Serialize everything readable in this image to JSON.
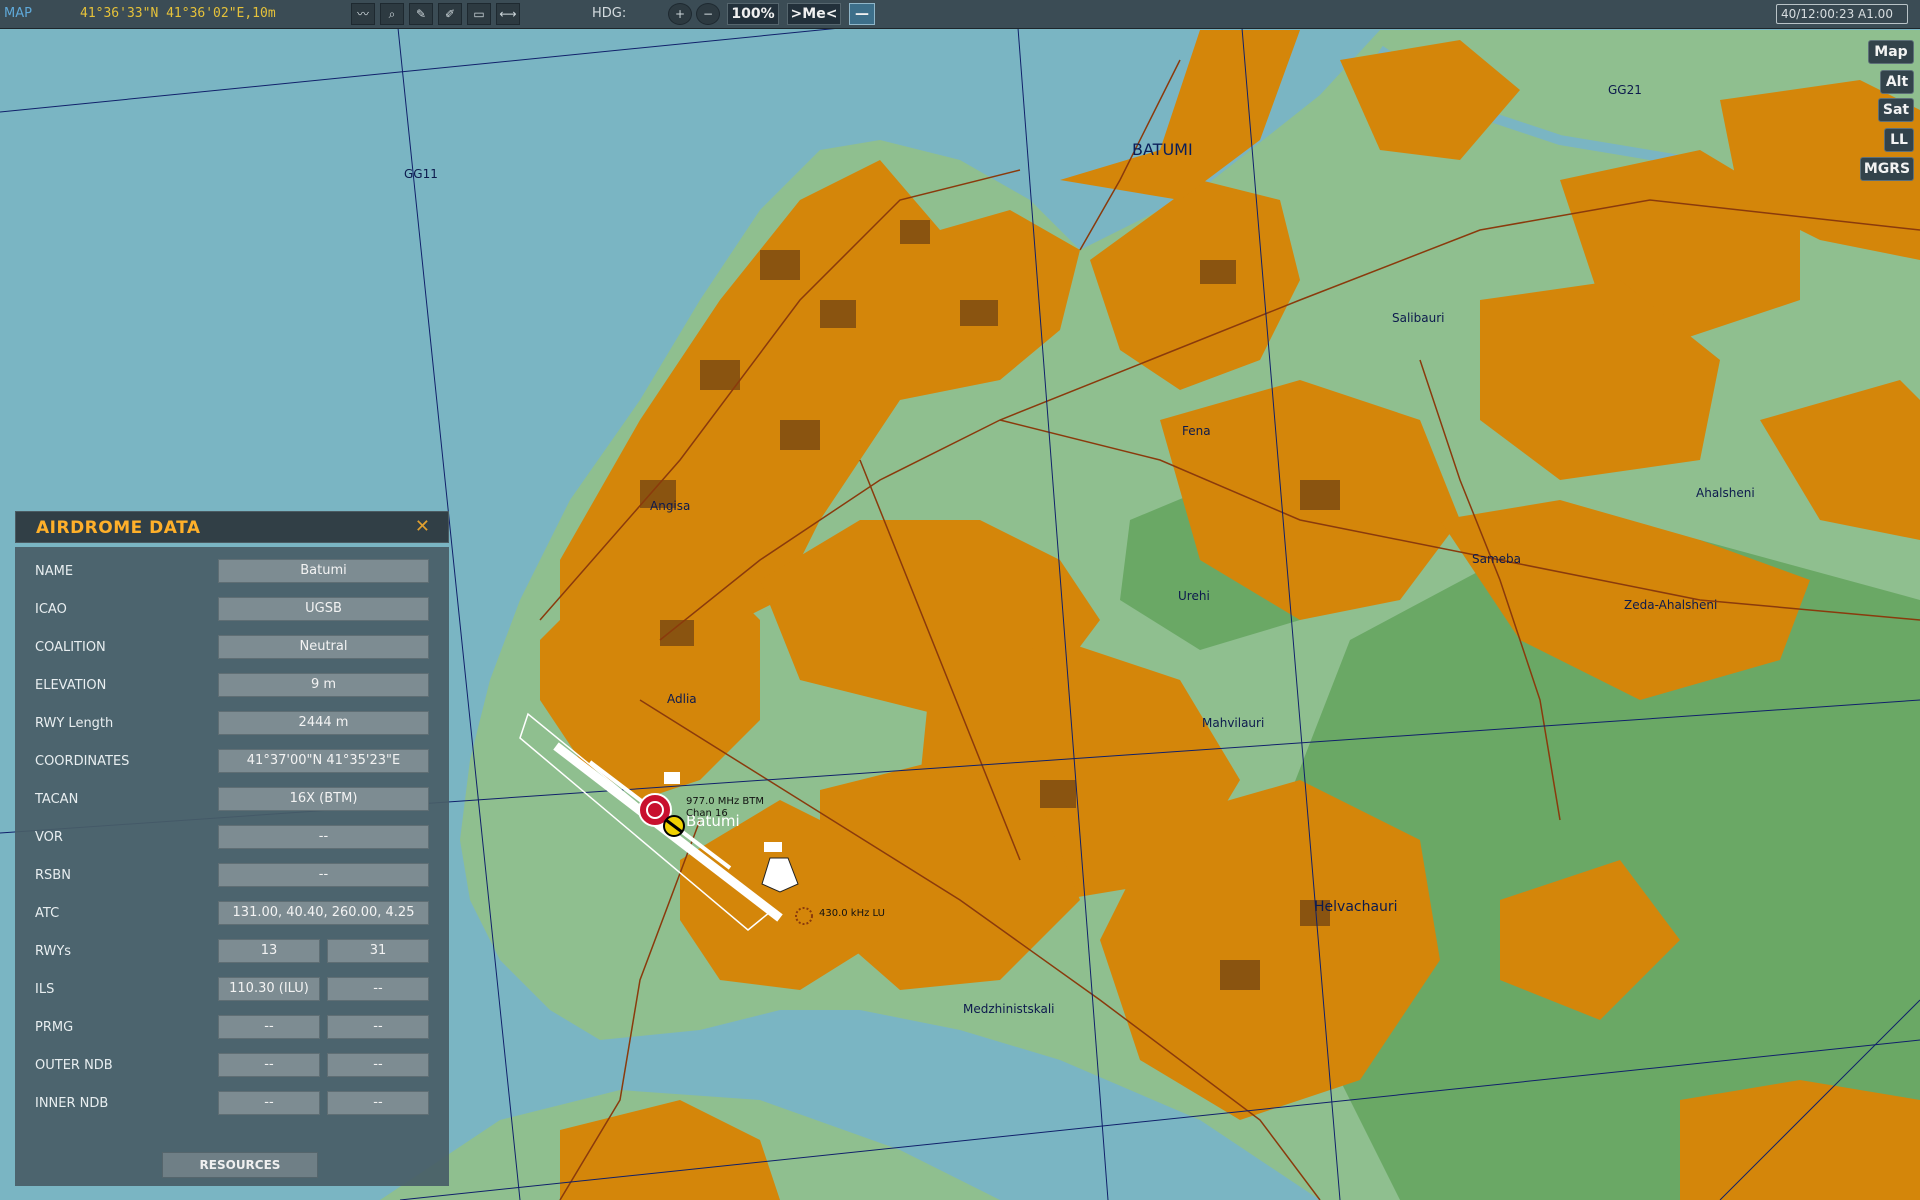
{
  "toolbar": {
    "title": "MAP",
    "cursor_coords": "41°36'33\"N 41°36'02\"E,10m",
    "heading_label": "HDG:",
    "zoom_in_label": "+",
    "zoom_out_label": "−",
    "zoom_level": "100%",
    "center_me_label": ">Me<",
    "minimize_label": "—",
    "mission_time": "40/12:00:23 A1.00",
    "tool_icons": [
      "route-tool-icon",
      "search-tool-icon",
      "draw-tool-icon",
      "ruler-tool-icon",
      "message-tool-icon",
      "measure-tool-icon"
    ]
  },
  "layers": [
    "Map",
    "Alt",
    "Sat",
    "LL",
    "MGRS"
  ],
  "map_labels": {
    "city": "BATUMI",
    "grid_gg11": "GG11",
    "grid_gg21": "GG21",
    "salibauri": "Salibauri",
    "fena": "Fena",
    "angisa": "Angisa",
    "ahalsheni": "Ahalsheni",
    "sameba": "Sameba",
    "urehi": "Urehi",
    "zeda": "Zeda-Ahalsheni",
    "adlia": "Adlia",
    "mahvilauri": "Mahvilauri",
    "helvachauri": "Helvachauri",
    "medzhinistskali": "Medzhinistskali",
    "airfield": "Batumi",
    "vor_freq": "977.0 MHz BTM",
    "vor_chan": "Chan 16",
    "ndb": "430.0 kHz LU"
  },
  "colors": {
    "water": "#7ab5c3",
    "land": "#8fbf8f",
    "urban": "#d4860a",
    "forest": "#6aa865",
    "accent": "#ffb02a"
  },
  "panel": {
    "title": "AIRDROME DATA",
    "close_label": "✕",
    "rows": [
      {
        "label": "NAME",
        "values": [
          "Batumi"
        ]
      },
      {
        "label": "ICAO",
        "values": [
          "UGSB"
        ]
      },
      {
        "label": "COALITION",
        "values": [
          "Neutral"
        ]
      },
      {
        "label": "ELEVATION",
        "values": [
          "9 m"
        ]
      },
      {
        "label": "RWY Length",
        "values": [
          "2444 m"
        ]
      },
      {
        "label": "COORDINATES",
        "values": [
          "41°37'00\"N 41°35'23\"E"
        ]
      },
      {
        "label": "TACAN",
        "values": [
          "16X (BTM)"
        ]
      },
      {
        "label": "VOR",
        "values": [
          "--"
        ]
      },
      {
        "label": "RSBN",
        "values": [
          "--"
        ]
      },
      {
        "label": "ATC",
        "values": [
          "131.00, 40.40, 260.00, 4.25"
        ]
      },
      {
        "label": "RWYs",
        "values": [
          "13",
          "31"
        ]
      },
      {
        "label": "ILS",
        "values": [
          "110.30 (ILU)",
          "--"
        ]
      },
      {
        "label": "PRMG",
        "values": [
          "--",
          "--"
        ]
      },
      {
        "label": "OUTER NDB",
        "values": [
          "--",
          "--"
        ]
      },
      {
        "label": "INNER NDB",
        "values": [
          "--",
          "--"
        ]
      }
    ],
    "resources_label": "RESOURCES"
  }
}
